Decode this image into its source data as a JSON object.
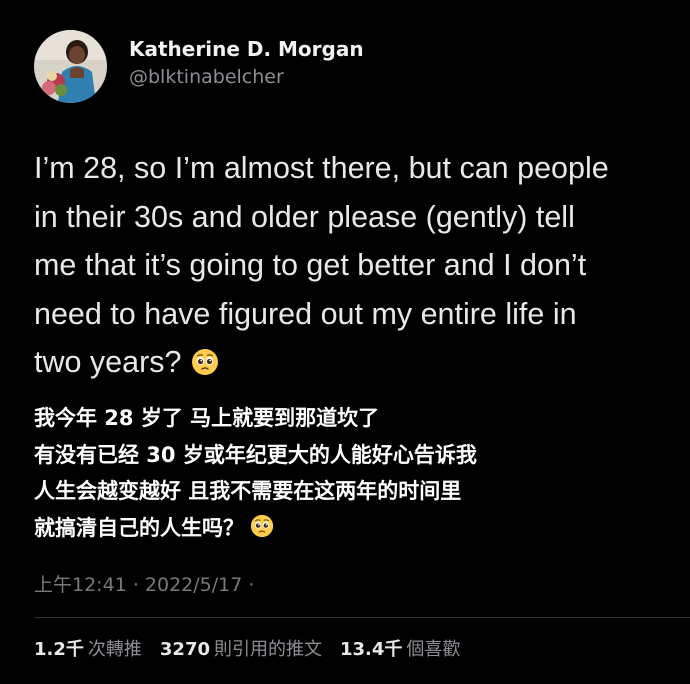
{
  "author": {
    "display_name": "Katherine D. Morgan",
    "handle": "@blktinabelcher"
  },
  "tweet": {
    "text_lines": [
      "I’m 28, so I’m almost there, but can people",
      "in their 30s and older please (gently) tell",
      "me that it’s going to get better and I don’t",
      "need to have figured out my entire life in",
      "two years?"
    ],
    "translation_lines": [
      "我今年 28 岁了 马上就要到那道坎了",
      "有没有已经 30 岁或年纪更大的人能好心告诉我",
      "人生会越变越好 且我不需要在这两年的时间里",
      "就搞清自己的人生吗？"
    ],
    "emoji": "pleading-face",
    "time": "上午12:41",
    "separator": "·",
    "date": "2022/5/17",
    "trailing_separator": "·"
  },
  "stats": {
    "retweets_count": "1.2千",
    "retweets_label": "次轉推",
    "quotes_count": "3270",
    "quotes_label": "則引用的推文",
    "likes_count": "13.4千",
    "likes_label": "個喜歡"
  },
  "colors": {
    "background": "#000000",
    "text": "#e7e9ea",
    "secondary_text": "#8b8f94",
    "divider": "#2f3336"
  }
}
